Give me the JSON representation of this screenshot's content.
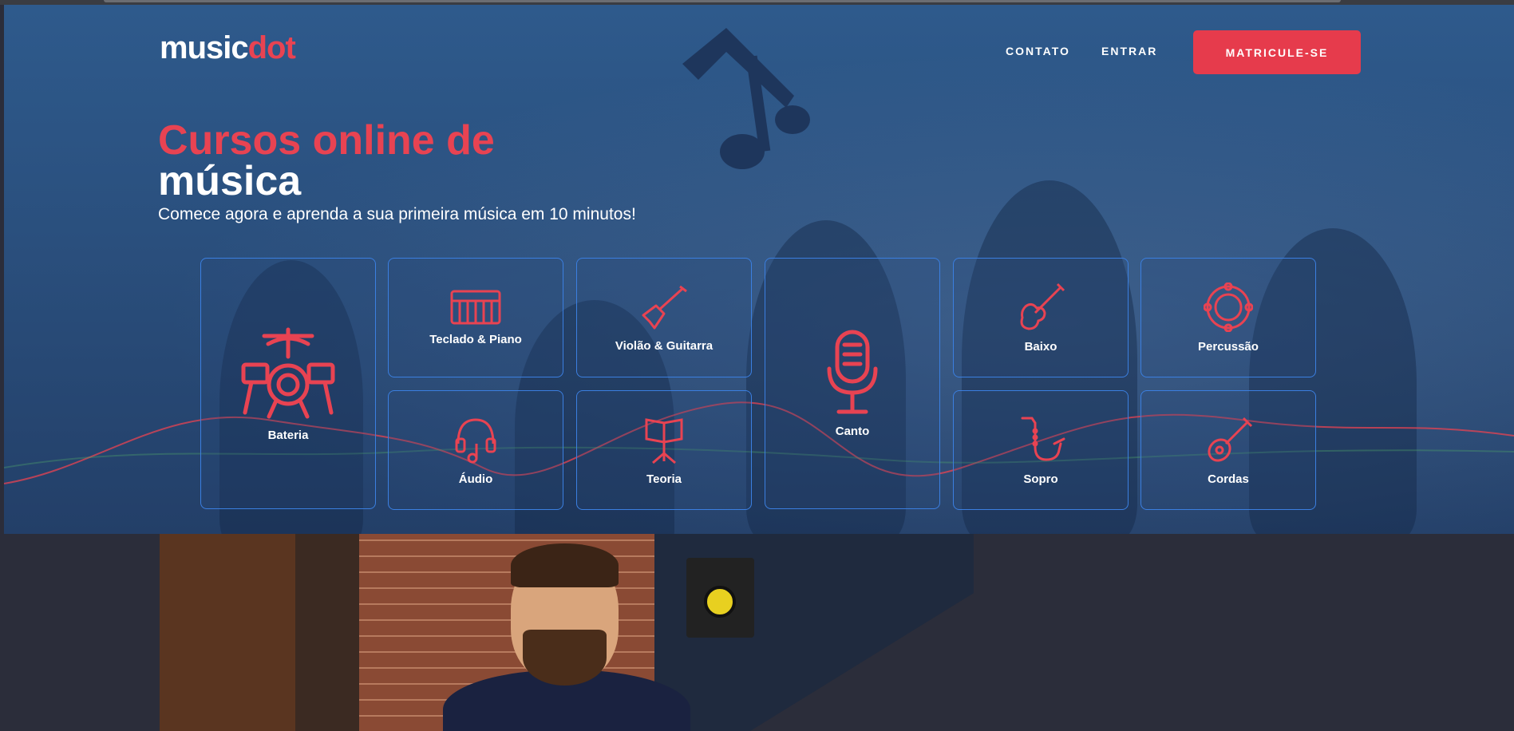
{
  "header": {
    "logo_text": "music",
    "logo_accent": "dot",
    "nav": [
      "CONTATO",
      "ENTRAR"
    ],
    "cta_label": "MATRICULE-SE"
  },
  "hero": {
    "title_line1": "Cursos online de",
    "title_line2": "música",
    "subtitle": "Comece agora e aprenda a sua primeira música em 10 minutos!"
  },
  "courses": [
    {
      "label": "Bateria",
      "icon": "drum-kit-icon"
    },
    {
      "label": "Teclado & Piano",
      "icon": "keyboard-icon"
    },
    {
      "label": "Violão & Guitarra",
      "icon": "guitar-icon"
    },
    {
      "label": "Canto",
      "icon": "microphone-icon"
    },
    {
      "label": "Baixo",
      "icon": "bass-icon"
    },
    {
      "label": "Percussão",
      "icon": "tambourine-icon"
    },
    {
      "label": "Áudio",
      "icon": "headphones-icon"
    },
    {
      "label": "Teoria",
      "icon": "music-stand-icon"
    },
    {
      "label": "Sopro",
      "icon": "saxophone-icon"
    },
    {
      "label": "Cordas",
      "icon": "mandolin-icon"
    }
  ],
  "colors": {
    "accent": "#e63b4c",
    "hero_bg": "#2a4f7d",
    "card_border": "#3b7fe0",
    "page_bg": "#2b2d3a"
  }
}
